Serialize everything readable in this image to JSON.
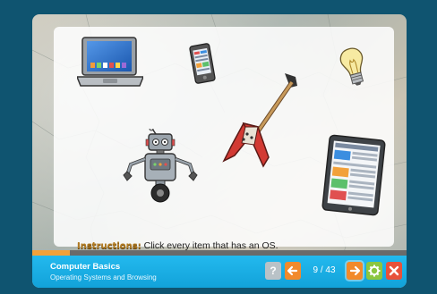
{
  "instructions": {
    "label": "Instructions:",
    "text": "Click every item that has an OS."
  },
  "items": [
    {
      "name": "laptop"
    },
    {
      "name": "smartphone"
    },
    {
      "name": "light-bulb"
    },
    {
      "name": "robot"
    },
    {
      "name": "electric-guitar"
    },
    {
      "name": "tablet"
    }
  ],
  "progress": {
    "fraction": 0.1
  },
  "footer": {
    "course_title": "Computer Basics",
    "lesson_title": "Operating Systems and Browsing",
    "page_counter": "9 / 43",
    "help_label": "?",
    "prev_label": "🡐",
    "next_label": "🡒",
    "settings_label": "⚙",
    "close_label": "✖"
  },
  "colors": {
    "accent_orange": "#f28a2b",
    "footer_blue": "#12a2d9",
    "settings_green": "#8cc63f",
    "close_red": "#e8513a",
    "page_background": "#0f5470"
  }
}
